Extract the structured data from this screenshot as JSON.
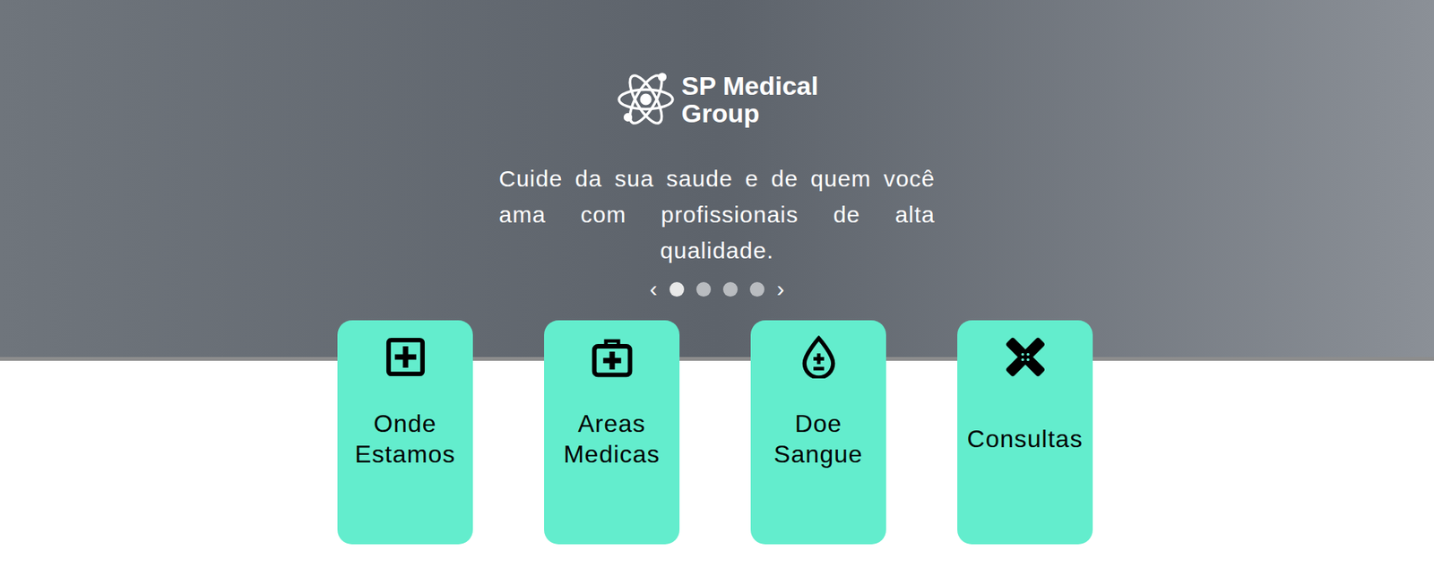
{
  "logo": {
    "lines": [
      "SP Medical",
      "Group"
    ]
  },
  "hero": {
    "tagline": "Cuide da sua saude e de quem você ama com profissionais de alta qualidade."
  },
  "carousel": {
    "prev": "‹",
    "next": "›",
    "dots": [
      {
        "selected": true
      },
      {
        "selected": false
      },
      {
        "selected": false
      },
      {
        "selected": false
      }
    ]
  },
  "cards": [
    {
      "label": "Onde Estamos",
      "icon": "plus-square"
    },
    {
      "label": "Areas Medicas",
      "icon": "medkit"
    },
    {
      "label": "Doe Sangue",
      "icon": "drop"
    },
    {
      "label": "Consultas",
      "icon": "bandage"
    }
  ]
}
